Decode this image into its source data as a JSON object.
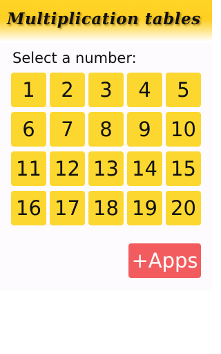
{
  "header": {
    "title": "Multiplication tables"
  },
  "prompt": "Select a number:",
  "numbers": [
    "1",
    "2",
    "3",
    "4",
    "5",
    "6",
    "7",
    "8",
    "9",
    "10",
    "11",
    "12",
    "13",
    "14",
    "15",
    "16",
    "17",
    "18",
    "19",
    "20"
  ],
  "apps_button": {
    "label": "+Apps"
  },
  "colors": {
    "header": "#ffd428",
    "number_button": "#fcd72f",
    "apps_button": "#f25c5e"
  }
}
